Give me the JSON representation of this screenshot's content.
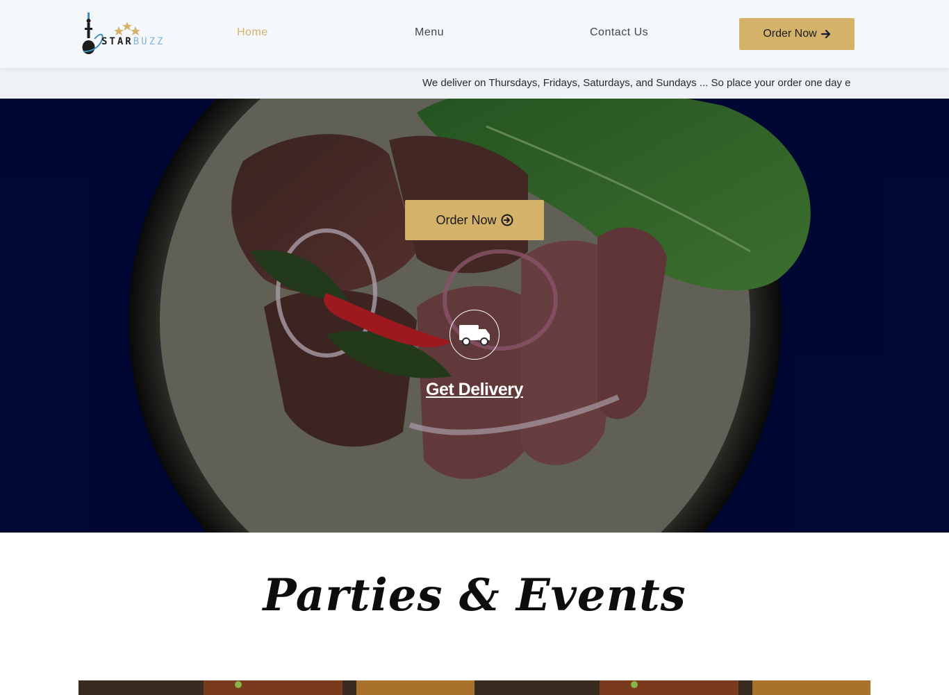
{
  "brand": {
    "logo_part1": "STAR",
    "logo_part2": "BUZZ"
  },
  "nav": {
    "items": [
      {
        "label": "Home",
        "active": true
      },
      {
        "label": "Menu",
        "active": false
      },
      {
        "label": "Contact Us",
        "active": false
      }
    ],
    "order_button": "Order Now",
    "order_icon": "arrow-right-icon"
  },
  "ticker": {
    "text": "We deliver on Thursdays, Fridays, Saturdays, and Sundays ... So place your order one day e"
  },
  "hero": {
    "order_button": "Order Now",
    "order_icon": "arrow-circle-right-icon",
    "delivery_icon": "truck-icon",
    "delivery_label": "Get Delivery"
  },
  "parties": {
    "title": "Parties & Events"
  },
  "colors": {
    "accent": "#d4b26a",
    "hero_bg": "#000a42",
    "header_bg": "#f5f8fa",
    "ticker_bg": "#eef1f5"
  }
}
